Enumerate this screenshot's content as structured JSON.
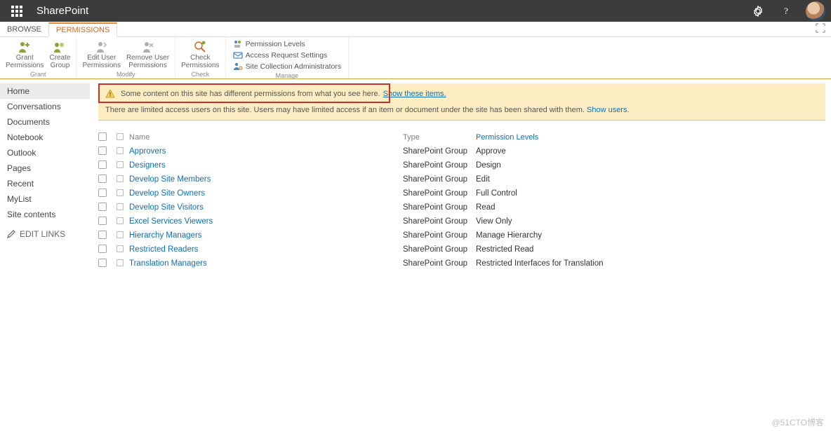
{
  "suite": {
    "app": "SharePoint"
  },
  "tabs": {
    "browse": "BROWSE",
    "permissions": "PERMISSIONS"
  },
  "ribbon": {
    "grant": {
      "grant": "Grant\nPermissions",
      "createGroup": "Create\nGroup",
      "label": "Grant"
    },
    "modify": {
      "editUser": "Edit User\nPermissions",
      "removeUser": "Remove User\nPermissions",
      "label": "Modify"
    },
    "check": {
      "check": "Check\nPermissions",
      "label": "Check"
    },
    "manage": {
      "levels": "Permission Levels",
      "access": "Access Request Settings",
      "admins": "Site Collection Administrators",
      "label": "Manage"
    }
  },
  "nav": {
    "items": [
      "Home",
      "Conversations",
      "Documents",
      "Notebook",
      "Outlook",
      "Pages",
      "Recent",
      "MyList",
      "Site contents"
    ],
    "editLinks": "EDIT LINKS"
  },
  "notices": {
    "diffPerms": "Some content on this site has different permissions from what you see here.",
    "showItems": "Show these items.",
    "limitedUsers": "There are limited access users on this site. Users may have limited access if an item or document under the site has been shared with them.",
    "showUsers": "Show users."
  },
  "columns": {
    "name": "Name",
    "type": "Type",
    "perm": "Permission Levels"
  },
  "rows": [
    {
      "name": "Approvers",
      "type": "SharePoint Group",
      "perm": "Approve"
    },
    {
      "name": "Designers",
      "type": "SharePoint Group",
      "perm": "Design"
    },
    {
      "name": "Develop Site Members",
      "type": "SharePoint Group",
      "perm": "Edit"
    },
    {
      "name": "Develop Site Owners",
      "type": "SharePoint Group",
      "perm": "Full Control"
    },
    {
      "name": "Develop Site Visitors",
      "type": "SharePoint Group",
      "perm": "Read"
    },
    {
      "name": "Excel Services Viewers",
      "type": "SharePoint Group",
      "perm": "View Only"
    },
    {
      "name": "Hierarchy Managers",
      "type": "SharePoint Group",
      "perm": "Manage Hierarchy"
    },
    {
      "name": "Restricted Readers",
      "type": "SharePoint Group",
      "perm": "Restricted Read"
    },
    {
      "name": "Translation Managers",
      "type": "SharePoint Group",
      "perm": "Restricted Interfaces for Translation"
    }
  ],
  "watermark": "@51CTO博客"
}
